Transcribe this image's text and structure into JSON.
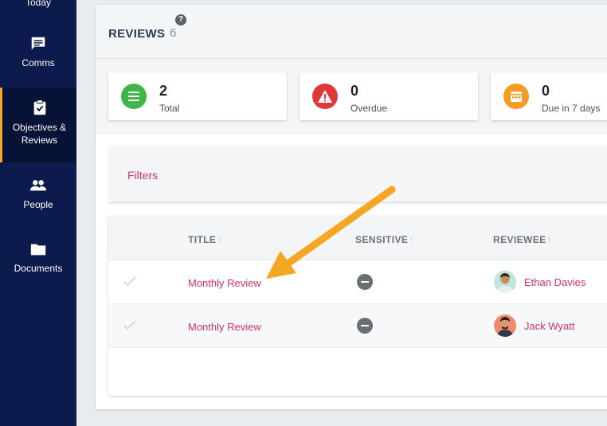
{
  "sidebar": {
    "items": [
      {
        "label": "Today",
        "icon": "sun-icon"
      },
      {
        "label": "Comms",
        "icon": "chat-icon"
      },
      {
        "label": "Objectives & Reviews",
        "icon": "clipboard-check-icon",
        "active": true
      },
      {
        "label": "People",
        "icon": "people-icon"
      },
      {
        "label": "Documents",
        "icon": "folder-icon"
      }
    ]
  },
  "header": {
    "title": "REVIEWS",
    "count": "6",
    "help": "?"
  },
  "stats": [
    {
      "value": "2",
      "label": "Total",
      "color": "#3fb54a",
      "icon": "list-icon"
    },
    {
      "value": "0",
      "label": "Overdue",
      "color": "#e0383a",
      "icon": "warning-icon"
    },
    {
      "value": "0",
      "label": "Due in 7 days",
      "color": "#f59a23",
      "icon": "calendar-icon"
    }
  ],
  "filters": {
    "label": "Filters"
  },
  "table": {
    "columns": [
      "TITLE",
      "SENSITIVE",
      "REVIEWEE"
    ],
    "rows": [
      {
        "title": "Monthly Review",
        "reviewee": "Ethan Davies"
      },
      {
        "title": "Monthly Review",
        "reviewee": "Jack Wyatt"
      }
    ]
  },
  "colors": {
    "sidebar": "#0c1a4d",
    "accent": "#d6336c",
    "active_border": "#f5a623",
    "annotation_arrow": "#f5a623"
  }
}
